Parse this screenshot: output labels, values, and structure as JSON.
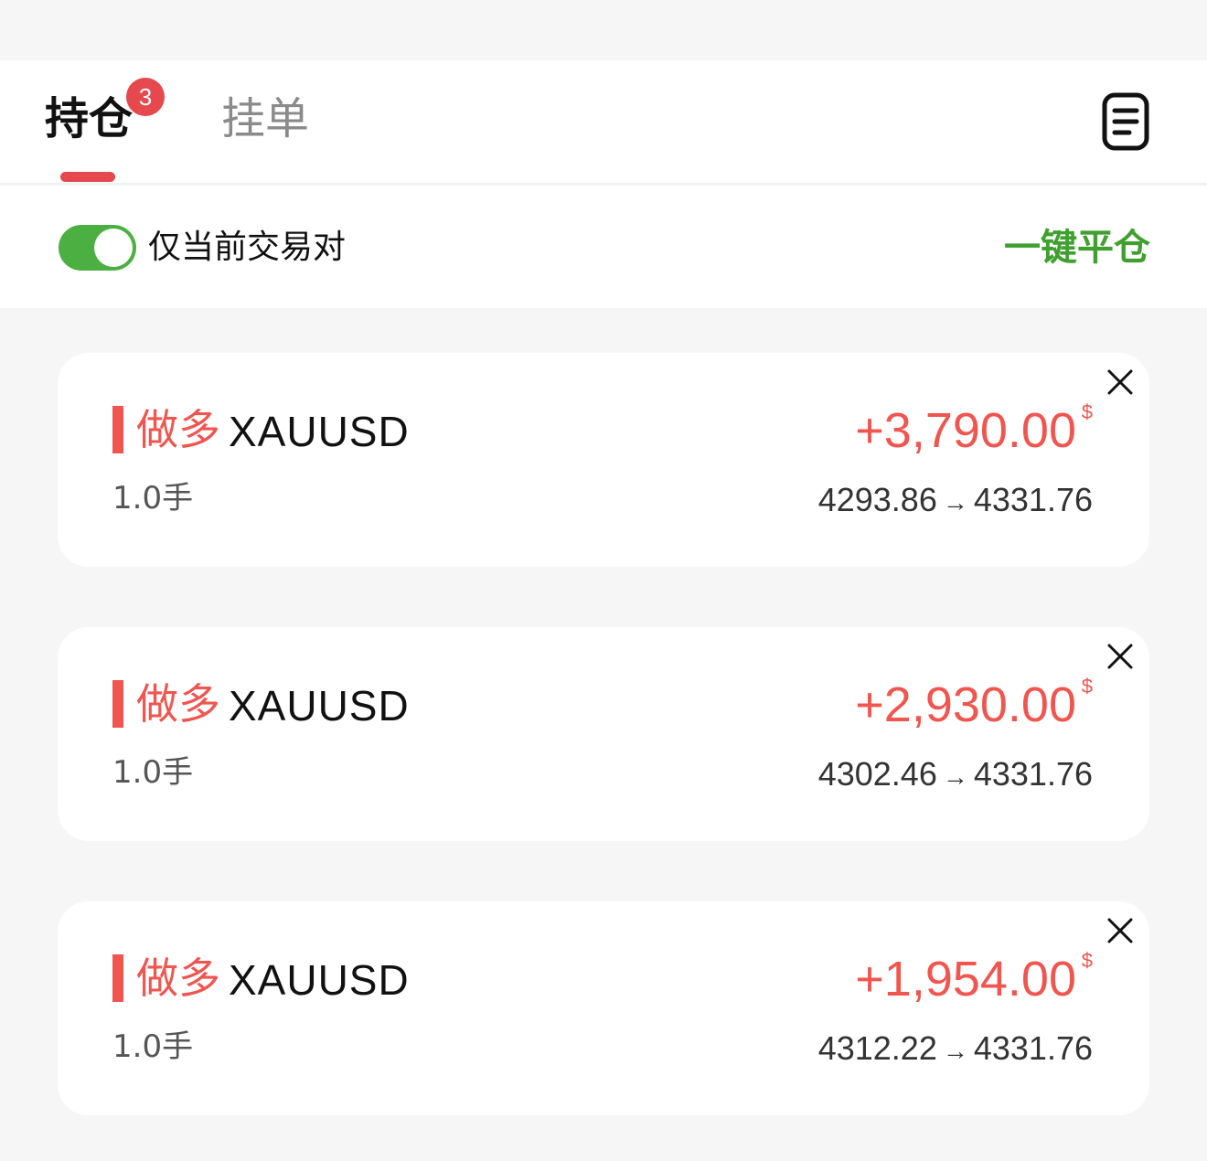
{
  "tabs": {
    "holdings_label": "持仓",
    "holdings_badge": "3",
    "pending_label": "挂单"
  },
  "filter": {
    "current_pair_only_label": "仅当前交易对",
    "current_pair_only_enabled": true,
    "close_all_label": "一键平仓"
  },
  "positions": [
    {
      "side": "做多",
      "symbol": "XAUUSD",
      "lots": "1.0手",
      "pnl": "+3,790.00",
      "currency": "$",
      "open_price": "4293.86",
      "arrow": "→",
      "current_price": "4331.76"
    },
    {
      "side": "做多",
      "symbol": "XAUUSD",
      "lots": "1.0手",
      "pnl": "+2,930.00",
      "currency": "$",
      "open_price": "4302.46",
      "arrow": "→",
      "current_price": "4331.76"
    },
    {
      "side": "做多",
      "symbol": "XAUUSD",
      "lots": "1.0手",
      "pnl": "+1,954.00",
      "currency": "$",
      "open_price": "4312.22",
      "arrow": "→",
      "current_price": "4331.76"
    }
  ],
  "colors": {
    "accent_red": "#e5484d",
    "profit_red": "#f0554f",
    "toggle_green": "#4bb041",
    "close_all_green": "#3fa02f"
  }
}
